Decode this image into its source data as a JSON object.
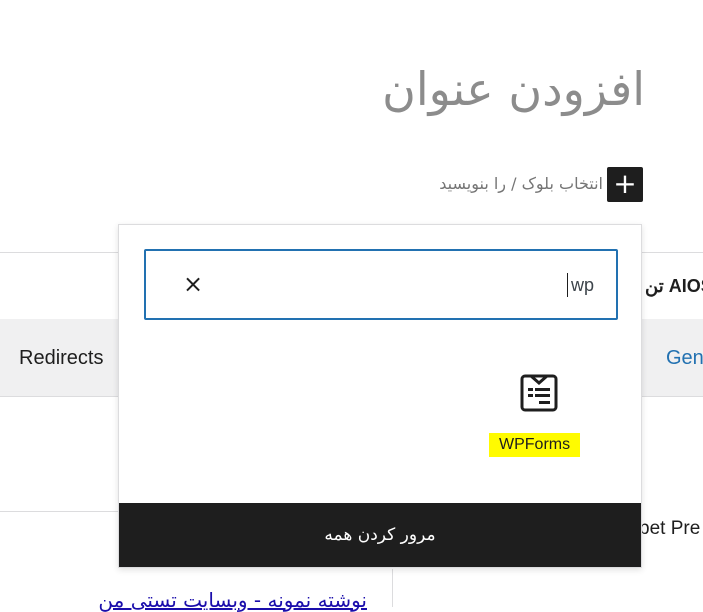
{
  "editor": {
    "title_placeholder": "افزودن عنوان",
    "block_hint": "انتخاب بلوک / را بنویسید",
    "add_block_symbol": "+"
  },
  "metabox": {
    "aioseo_label": "AIOS تن",
    "tabs": [
      {
        "label": "Redirects"
      },
      {
        "label": "Gen"
      }
    ],
    "snippet_label": "pet Pre",
    "snippet_title": "نوشته نمونه - وبسایت تستی من"
  },
  "inserter": {
    "search_value": "wp",
    "clear_symbol": "×",
    "results": [
      {
        "label": "WPForms",
        "icon": "wpforms-icon"
      }
    ],
    "browse_all_label": "مرور کردن همه"
  },
  "colors": {
    "accent": "#2271b1",
    "highlight": "#fffb00",
    "dark": "#1e1e1e"
  }
}
